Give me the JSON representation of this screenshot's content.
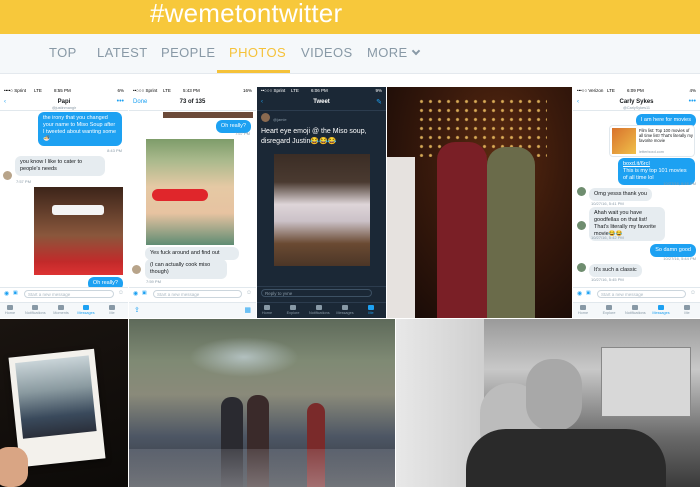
{
  "header": {
    "hashtag": "#wemetontwitter",
    "bar_color": "#f7c83b"
  },
  "tabs": [
    {
      "label": "TOP"
    },
    {
      "label": "LATEST"
    },
    {
      "label": "PEOPLE"
    },
    {
      "label": "PHOTOS",
      "active": true
    },
    {
      "label": "VIDEOS"
    },
    {
      "label": "MORE"
    }
  ],
  "accent": "#f5c23a",
  "tiles": {
    "dm1": {
      "carrier": "••••○ Sprint",
      "network": "LTE",
      "time": "8:55 PM",
      "battery": "6%",
      "name": "Papi",
      "handle": "@justinmangir",
      "msg1": "the irony that you changed your name to Miso Soup after I tweeted about wanting some 🍜",
      "msg1_time": "8:43 PM",
      "msg2": "you know I like to cater to people's needs",
      "msg2_time": "7:57 PM",
      "msg3": "Oh really?",
      "composer_placeholder": "Start a new message",
      "tabbar": [
        "Home",
        "Notifications",
        "Moments",
        "Messages",
        "Me"
      ]
    },
    "dm2": {
      "carrier": "••○○○ Sprint",
      "network": "LTE",
      "time": "5:43 PM",
      "battery": "16%",
      "done": "Done",
      "counter": "73 of 135",
      "msg1": "Oh really?",
      "msg1_time": "7:57 PM",
      "msg2": "Yes fuck around and find out",
      "msg3": "(I can actually cook miso though)",
      "msg3_time": "7:59 PM",
      "composer_placeholder": "Start a new message"
    },
    "tweet": {
      "carrier": "••○○○ Sprint",
      "network": "LTE",
      "time": "6:06 PM",
      "battery": "9%",
      "title": "Tweet",
      "handle": "@jamie",
      "text": "Heart eye emoji @ the Miso soup, disregard Justin😂😂😂",
      "reply_placeholder": "Reply to yvne",
      "tabbar": [
        "Home",
        "Explore",
        "Notifications",
        "Messages",
        "Me"
      ]
    },
    "dm3": {
      "carrier": "•••○○ Verizon",
      "network": "LTE",
      "time": "6:09 PM",
      "battery": "4%",
      "name": "Carly Sykes",
      "handle": "@CarlySykes11",
      "msg1": "I am here for movies",
      "card_title": "Film list: Top 100 movies of all time list! That's literally my favorite movie",
      "card_domain": "letterboxd.com",
      "msg2_link": "boxd.it/6rcI",
      "msg2": "This is my top 101 movies of all time lol",
      "msg2_time": "10/27/16, 6:16 PM",
      "msg3": "Omg yesss thank you",
      "msg3_time": "10/27/16, 5:41 PM",
      "msg4": "Ahah wait you have goodfellas on that list! That's literally my favorite movie😂😂",
      "msg4_time": "10/27/16, 5:42 PM",
      "msg5": "So damn good",
      "msg5_time": "10/27/16, 5:44 PM",
      "msg6": "It's such a classic",
      "msg6_time": "10/27/16, 5:45 PM",
      "composer_placeholder": "Start a new message",
      "tabbar": [
        "Home",
        "Explore",
        "Notifications",
        "Messages",
        "Me"
      ]
    }
  }
}
